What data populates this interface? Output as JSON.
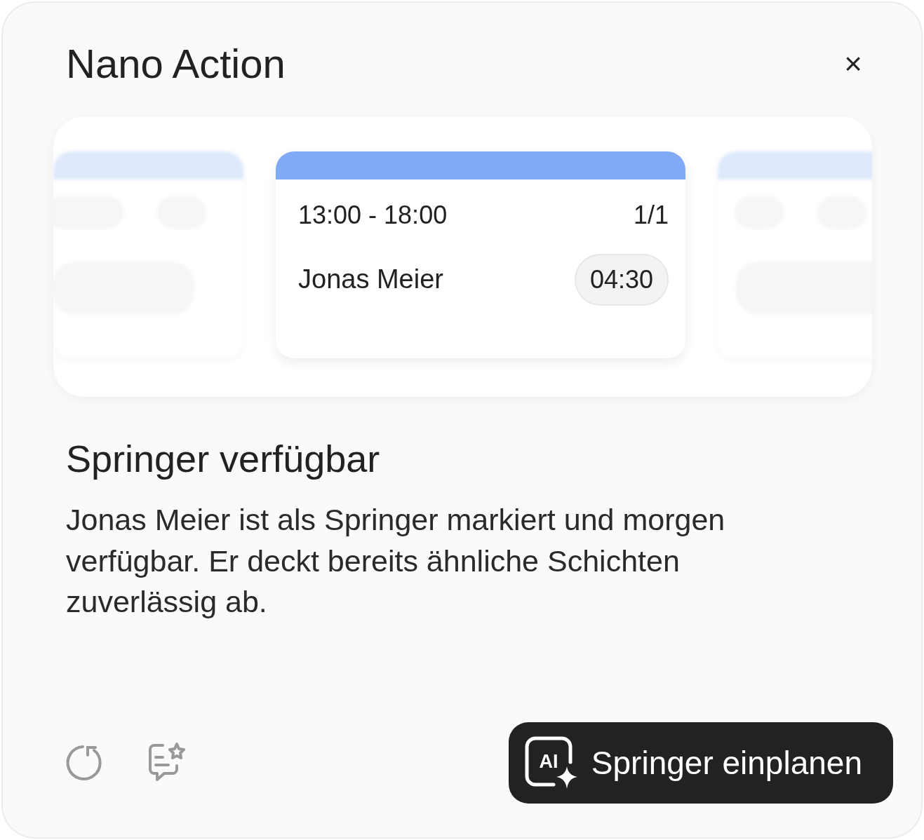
{
  "dialog": {
    "title": "Nano Action",
    "close": "×"
  },
  "preview": {
    "shift": {
      "time": "13:00 - 18:00",
      "count": "1/1",
      "employee": "Jonas Meier",
      "duration": "04:30"
    }
  },
  "heading": "Springer verfügbar",
  "description": "Jonas Meier ist als Springer markiert und morgen verfügbar. Er deckt bereits ähnliche Schichten zuverlässig ab.",
  "primary_button": {
    "icon_text": "AI",
    "label": "Springer einplanen"
  }
}
